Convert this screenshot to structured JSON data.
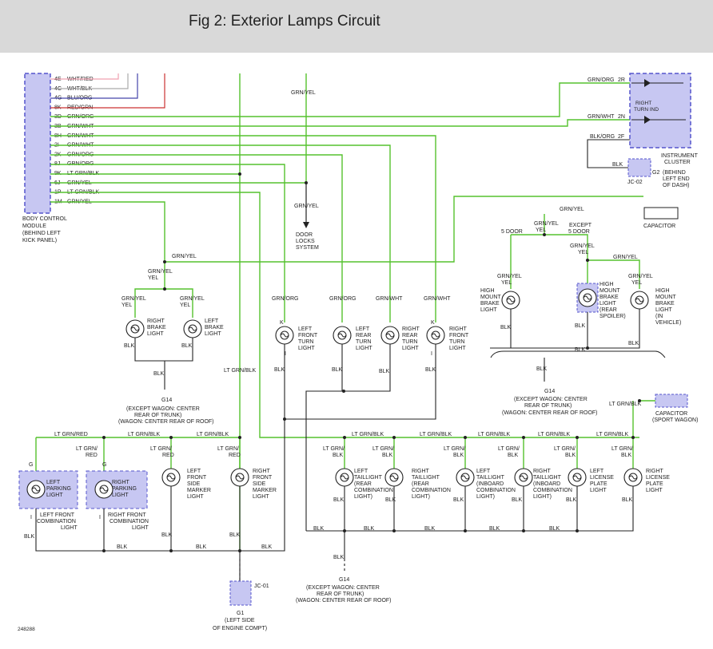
{
  "header": {
    "title": "Fig 2: Exterior Lamps Circuit"
  },
  "colors": {
    "green": "#55c22e",
    "dark": "#222222",
    "box_fill": "#c7c7f2",
    "box_border": "#5555cc"
  },
  "bcm": {
    "label_lines": [
      "BODY CONTROL",
      "MODULE",
      "(BEHIND LEFT",
      "KICK PANEL)"
    ],
    "pins": [
      {
        "pin": "4E",
        "wire": "WHT/RED"
      },
      {
        "pin": "4C",
        "wire": "WHT/BLK"
      },
      {
        "pin": "4G",
        "wire": "BLU/ORG"
      },
      {
        "pin": "8K",
        "wire": "RED/GRN"
      },
      {
        "pin": "3D",
        "wire": "GRN/ORG"
      },
      {
        "pin": "3B",
        "wire": "GRN/WHT"
      },
      {
        "pin": "8H",
        "wire": "GRN/WHT"
      },
      {
        "pin": "2I",
        "wire": "GRN/WHT"
      },
      {
        "pin": "2K",
        "wire": "GRN/ORG"
      },
      {
        "pin": "8J",
        "wire": "GRN/ORG"
      },
      {
        "pin": "9K",
        "wire": "LT GRN/BLK"
      },
      {
        "pin": "6J",
        "wire": "GRN/YEL"
      },
      {
        "pin": "1P",
        "wire": "LT GRN/BLK"
      },
      {
        "pin": "1M",
        "wire": "GRN/YEL"
      }
    ]
  },
  "cluster": {
    "label_lines": [
      "INSTRUMENT",
      "CLUSTER",
      "(BEHIND",
      "LEFT END",
      "OF DASH)"
    ],
    "right_turn_ind": [
      "RIGHT",
      "TURN IND"
    ],
    "pins": [
      {
        "pin": "2R",
        "wire": "GRN/ORG"
      },
      {
        "pin": "2N",
        "wire": "GRN/WHT"
      },
      {
        "pin": "2F",
        "wire": "BLK/ORG"
      }
    ],
    "g2": "G2",
    "jc02": "JC-02",
    "blk": "BLK"
  },
  "door_locks": {
    "lines": [
      "DOOR",
      "LOCKS",
      "SYSTEM"
    ],
    "wire": "GRN/YEL",
    "wire_top": "GRN/YEL"
  },
  "capacitor_top": {
    "label": "CAPACITOR",
    "wire": "GRN/YEL"
  },
  "capacitor_sport": {
    "lines": [
      "CAPACITOR",
      "(SPORT WAGON)"
    ],
    "wire": "LT GRN/BLK"
  },
  "brake": {
    "bus_wire": "GRN/YEL",
    "right": [
      "RIGHT",
      "BRAKE",
      "LIGHT"
    ],
    "left": [
      "LEFT",
      "BRAKE",
      "LIGHT"
    ],
    "wire": "GRN/YEL",
    "blk": "BLK"
  },
  "turn": {
    "lf": {
      "lines": [
        "LEFT",
        "FRONT",
        "TURN",
        "LIGHT"
      ],
      "wire": "GRN/ORG"
    },
    "lr": {
      "lines": [
        "LEFT",
        "REAR",
        "TURN",
        "LIGHT"
      ],
      "wire": "GRN/ORG"
    },
    "rr": {
      "lines": [
        "RIGHT",
        "REAR",
        "TURN",
        "LIGHT"
      ],
      "wire": "GRN/WHT"
    },
    "rf": {
      "lines": [
        "RIGHT",
        "FRONT",
        "TURN",
        "LIGHT"
      ],
      "wire": "GRN/WHT"
    },
    "blk": "BLK",
    "k": "K",
    "i": "I"
  },
  "hmsl": {
    "five_door": "5 DOOR",
    "except": [
      "EXCEPT",
      "5 DOOR"
    ],
    "left": [
      "HIGH",
      "MOUNT",
      "BRAKE",
      "LIGHT"
    ],
    "mid": [
      "HIGH",
      "MOUNT",
      "BRAKE",
      "LIGHT",
      "(REAR",
      "SPOILER)"
    ],
    "right": [
      "HIGH",
      "MOUNT",
      "BRAKE",
      "LIGHT",
      "(IN",
      "VEHICLE)"
    ],
    "wire": "GRN/YEL",
    "blk": "BLK"
  },
  "g14_a": {
    "name": "G14",
    "lines": [
      "(EXCEPT WAGON: CENTER",
      "REAR OF TRUNK)",
      "(WAGON: CENTER REAR OF ROOF)"
    ]
  },
  "g14_b": {
    "name": "G14",
    "lines": [
      "(EXCEPT WAGON: CENTER",
      "REAR OF TRUNK)",
      "(WAGON: CENTER REAR OF ROOF)"
    ]
  },
  "g14_c": {
    "name": "G14",
    "lines": [
      "(EXCEPT WAGON: CENTER",
      "REAR OF TRUNK)",
      "(WAGON: CENTER REAR OF ROOF)"
    ]
  },
  "g1": {
    "name": "G1",
    "jc": "JC-01",
    "lines": [
      "(LEFT SIDE",
      "OF ENGINE COMPT)"
    ]
  },
  "lower": {
    "bus_wire": "LT GRN/RED",
    "bus_wire2": "LT GRN/BLK",
    "lt_grn_blk_vert": "LT GRN/ BLK",
    "lpl": {
      "lines": [
        "LEFT",
        "PARKING",
        "LIGHT"
      ],
      "sub": [
        "LEFT FRONT",
        "COMBINATION",
        "LIGHT"
      ],
      "wire": "LT GRN/ RED"
    },
    "rpl": {
      "lines": [
        "RIGHT",
        "PARKING",
        "LIGHT"
      ],
      "sub": [
        "RIGHT FRONT",
        "COMBINATION",
        "LIGHT"
      ],
      "wire": "LT GRN/ RED"
    },
    "lfsm": {
      "lines": [
        "LEFT",
        "FRONT",
        "SIDE",
        "MARKER",
        "LIGHT"
      ],
      "wire": "LT GRN/ RED"
    },
    "rfsm": {
      "lines": [
        "RIGHT",
        "FRONT",
        "SIDE",
        "MARKER",
        "LIGHT"
      ],
      "wire": "LT GRN/ RED"
    },
    "ltl": {
      "lines": [
        "LEFT",
        "TAILLIGHT",
        "(REAR",
        "COMBINATION",
        "LIGHT)"
      ],
      "wire": "LT GRN/ BLK"
    },
    "rtl": {
      "lines": [
        "RIGHT",
        "TAILLIGHT",
        "(REAR",
        "COMBINATION",
        "LIGHT)"
      ],
      "wire": "LT GRN/ BLK"
    },
    "ltli": {
      "lines": [
        "LEFT",
        "TAILLIGHT",
        "(INBOARD",
        "COMBINATION",
        "LIGHT)"
      ],
      "wire": "LT GRN/ BLK"
    },
    "rtli": {
      "lines": [
        "RIGHT",
        "TAILLIGHT",
        "(INBOARD",
        "COMBINATION",
        "LIGHT)"
      ],
      "wire": "LT GRN/ BLK"
    },
    "llp": {
      "lines": [
        "LEFT",
        "LICENSE",
        "PLATE",
        "LIGHT"
      ],
      "wire": "LT GRN/ BLK"
    },
    "rlp": {
      "lines": [
        "RIGHT",
        "LICENSE",
        "PLATE",
        "LIGHT"
      ],
      "wire": "LT GRN/ BLK"
    },
    "blk": "BLK",
    "g": "G",
    "i": "I"
  },
  "figure_id": "248288"
}
